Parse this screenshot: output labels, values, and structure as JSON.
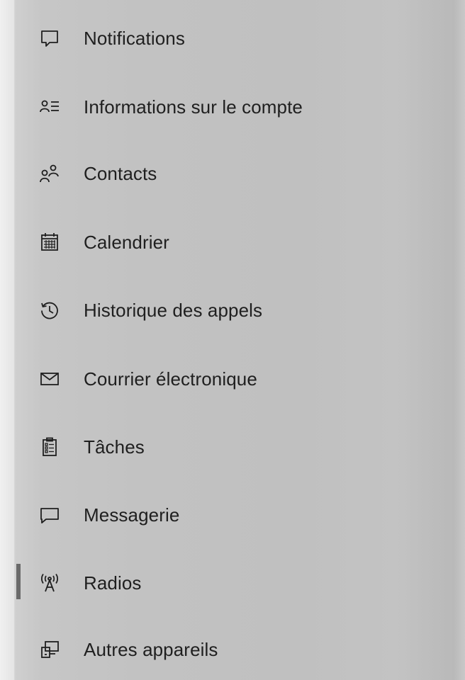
{
  "sidebar": {
    "selected_index": 8,
    "items": [
      {
        "label": "Notifications",
        "icon": "notification-icon"
      },
      {
        "label": "Informations sur le compte",
        "icon": "account-info-icon"
      },
      {
        "label": "Contacts",
        "icon": "contacts-icon"
      },
      {
        "label": "Calendrier",
        "icon": "calendar-icon"
      },
      {
        "label": "Historique des appels",
        "icon": "call-history-icon"
      },
      {
        "label": "Courrier électronique",
        "icon": "mail-icon"
      },
      {
        "label": "Tâches",
        "icon": "tasks-icon"
      },
      {
        "label": "Messagerie",
        "icon": "messaging-icon"
      },
      {
        "label": "Radios",
        "icon": "radio-antenna-icon"
      },
      {
        "label": "Autres appareils",
        "icon": "other-devices-icon"
      }
    ]
  },
  "colors": {
    "background": "#c2c2c2",
    "text": "#1f1f1f",
    "selection_indicator": "#6a6a6a"
  }
}
